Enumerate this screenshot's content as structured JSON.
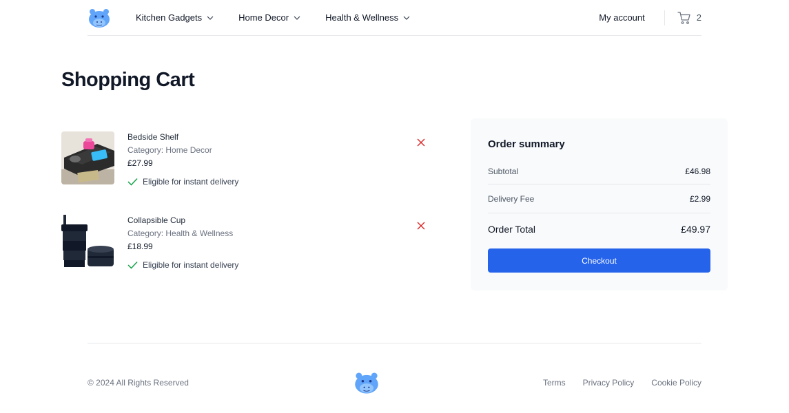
{
  "header": {
    "nav": [
      {
        "label": "Kitchen Gadgets"
      },
      {
        "label": "Home Decor"
      },
      {
        "label": "Health & Wellness"
      }
    ],
    "account_label": "My account",
    "cart_count": "2"
  },
  "page": {
    "title": "Shopping Cart"
  },
  "cart": {
    "items": [
      {
        "name": "Bedside Shelf",
        "category_label": "Category:",
        "category": "Home Decor",
        "price": "£27.99",
        "delivery": "Eligible for instant delivery"
      },
      {
        "name": "Collapsible Cup",
        "category_label": "Category:",
        "category": "Health & Wellness",
        "price": "£18.99",
        "delivery": "Eligible for instant delivery"
      }
    ]
  },
  "summary": {
    "title": "Order summary",
    "subtotal_label": "Subtotal",
    "subtotal": "£46.98",
    "fee_label": "Delivery Fee",
    "fee": "£2.99",
    "total_label": "Order Total",
    "total": "£49.97",
    "checkout_label": "Checkout"
  },
  "footer": {
    "copyright": "© 2024 All Rights Reserved",
    "links": [
      {
        "label": "Terms"
      },
      {
        "label": "Privacy Policy"
      },
      {
        "label": "Cookie Policy"
      }
    ]
  },
  "colors": {
    "accent": "#2563eb",
    "remove": "#dc2626",
    "check": "#16a34a",
    "logo": "#60a5fa"
  },
  "icons": {
    "logo": "hippo-logo-icon",
    "cart": "cart-icon",
    "remove": "close-icon",
    "delivery": "check-icon",
    "nav": "chevron-down-icon"
  }
}
